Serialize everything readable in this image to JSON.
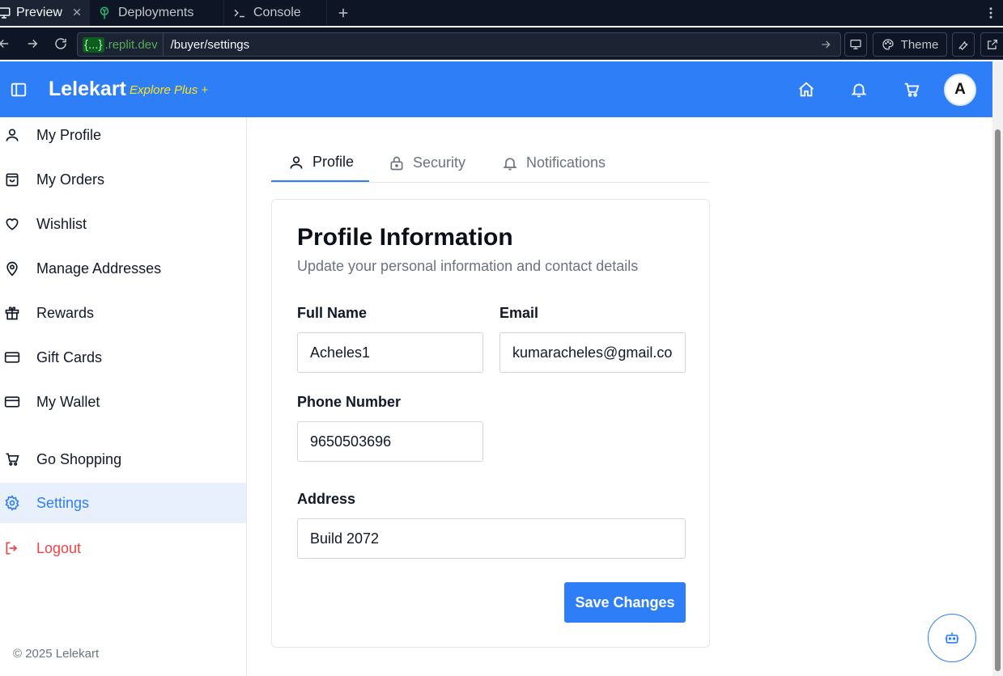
{
  "browser": {
    "tabs": [
      {
        "label": "Preview"
      },
      {
        "label": "Deployments"
      },
      {
        "label": "Console"
      }
    ],
    "url": {
      "domain_brace": "{...}",
      "domain": ".replit.dev",
      "path": "/buyer/settings"
    },
    "theme_label": "Theme"
  },
  "header": {
    "brand": "Lelekart",
    "brand_sub": "Explore Plus +",
    "avatar_initial": "A"
  },
  "sidebar": {
    "items": [
      {
        "label": "My Profile"
      },
      {
        "label": "My Orders"
      },
      {
        "label": "Wishlist"
      },
      {
        "label": "Manage Addresses"
      },
      {
        "label": "Rewards"
      },
      {
        "label": "Gift Cards"
      },
      {
        "label": "My Wallet"
      },
      {
        "label": "Go Shopping"
      },
      {
        "label": "Settings"
      },
      {
        "label": "Logout"
      }
    ],
    "copyright": "© 2025 Lelekart"
  },
  "settings_tabs": [
    {
      "label": "Profile"
    },
    {
      "label": "Security"
    },
    {
      "label": "Notifications"
    }
  ],
  "profile": {
    "title": "Profile Information",
    "subtitle": "Update your personal information and contact details",
    "full_name": {
      "label": "Full Name",
      "value": "Acheles1"
    },
    "email": {
      "label": "Email",
      "value": "kumaracheles@gmail.com"
    },
    "phone": {
      "label": "Phone Number",
      "value": "9650503696"
    },
    "address": {
      "label": "Address",
      "value": "Build 2072"
    },
    "save_label": "Save Changes"
  },
  "colors": {
    "primary": "#2d7ef7",
    "brand_sub": "#ffe11b",
    "logout": "#ef4444",
    "chrome_bg": "#0e1525"
  }
}
